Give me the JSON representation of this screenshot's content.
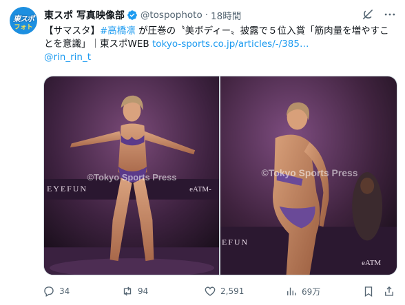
{
  "post": {
    "avatar_top": "東スポ",
    "avatar_bottom": "フォト",
    "display_name": "東スポ 写真映像部",
    "handle": "@tospophoto",
    "separator": "·",
    "time": "18時間",
    "text_part1": "【サマスタ】",
    "hashtag": "#高橋凛",
    "text_part2": " が圧巻の〝美ボディー〟披露で５位入賞「筋肉量を増やすことを意識」｜東スポWEB ",
    "link": "tokyo-sports.co.jp/articles/-/385…",
    "mention": "@rin_rin_t"
  },
  "media": {
    "left_watermark": "©Tokyo Sports Press",
    "right_watermark": "©Tokyo Sports Press",
    "left_banner": "EYEFUN",
    "left_banner2": "eATM-",
    "right_banner": "EFUN",
    "right_banner2": "eATM"
  },
  "actions": {
    "replies": "34",
    "reposts": "94",
    "likes": "2,591",
    "views": "69万"
  },
  "icons": [
    "grok-icon",
    "more-icon",
    "verified-icon",
    "reply-icon",
    "repost-icon",
    "like-icon",
    "views-icon",
    "bookmark-icon",
    "share-icon"
  ],
  "colors": {
    "accent": "#1d9bf0",
    "muted": "#536471",
    "verified": "#1d9bf0"
  }
}
